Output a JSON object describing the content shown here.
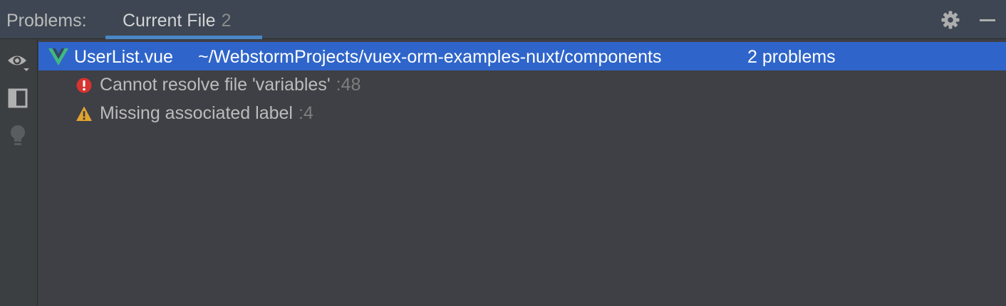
{
  "header": {
    "title": "Problems:",
    "tab": {
      "label": "Current File",
      "count": "2"
    },
    "icons": [
      "gear-icon",
      "minimize-icon"
    ]
  },
  "toolbar": {
    "icons": [
      "eye-icon",
      "preview-icon",
      "lightbulb-icon"
    ]
  },
  "file": {
    "icon": "vue-file-icon",
    "name": "UserList.vue",
    "path": "~/WebstormProjects/vuex-orm-examples-nuxt/components",
    "count": "2 problems"
  },
  "problems": [
    {
      "severity": "error",
      "icon": "error-icon",
      "text": "Cannot resolve file 'variables'",
      "line": ":48"
    },
    {
      "severity": "warning",
      "icon": "warning-icon",
      "text": "Missing associated label",
      "line": ":4"
    }
  ],
  "colors": {
    "selection": "#2f65ca",
    "tab_underline": "#4a88c7",
    "error": "#d7332f",
    "warning": "#e0a52f",
    "vue_green": "#41b883"
  }
}
